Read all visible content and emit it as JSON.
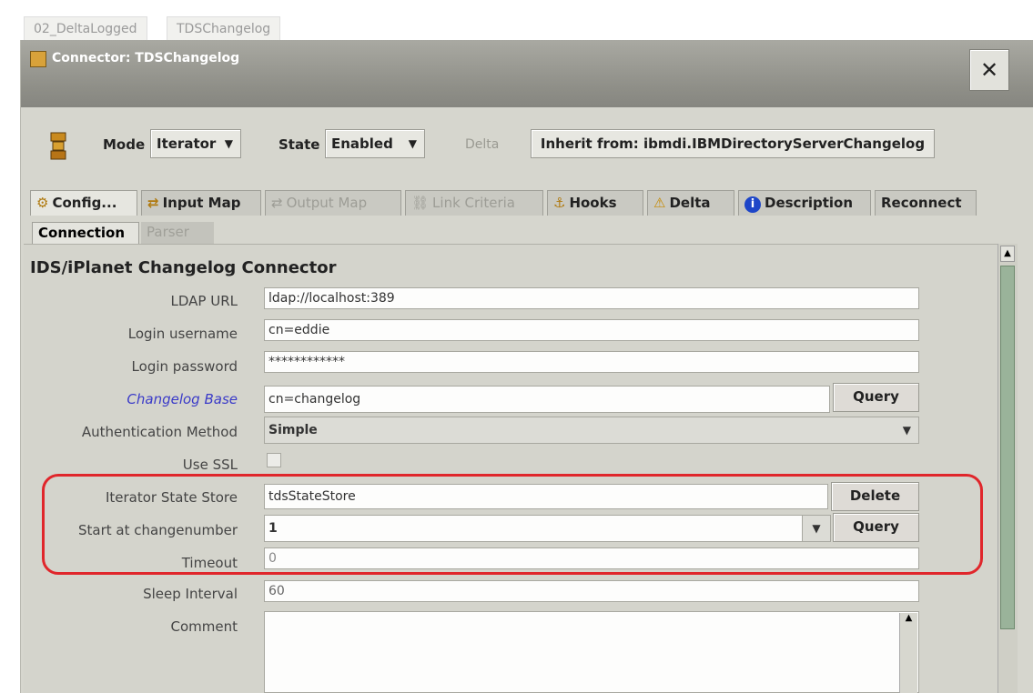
{
  "outer_tabs": [
    "02_DeltaLogged",
    "TDSChangelog"
  ],
  "window": {
    "title": "Connector: TDSChangelog"
  },
  "toolbar": {
    "mode_label": "Mode",
    "mode_value": "Iterator",
    "state_label": "State",
    "state_value": "Enabled",
    "delta_label": "Delta",
    "inherit_label": "Inherit from: ibmdi.IBMDirectoryServerChangelog"
  },
  "tabs": [
    "Config...",
    "Input Map",
    "Output Map",
    "Link Criteria",
    "Hooks",
    "Delta",
    "Description",
    "Reconnect"
  ],
  "subtabs": [
    "Connection",
    "Parser"
  ],
  "section_title": "IDS/iPlanet Changelog Connector",
  "fields": {
    "ldap_url": {
      "label": "LDAP URL",
      "value": "ldap://localhost:389"
    },
    "login_username": {
      "label": "Login username",
      "value": "cn=eddie"
    },
    "login_password": {
      "label": "Login password",
      "value": "************"
    },
    "changelog_base": {
      "label": "Changelog Base",
      "value": "cn=changelog",
      "button": "Query"
    },
    "auth_method": {
      "label": "Authentication Method",
      "value": "Simple"
    },
    "use_ssl": {
      "label": "Use SSL"
    },
    "iterator_state_store": {
      "label": "Iterator State Store",
      "value": "tdsStateStore",
      "button": "Delete"
    },
    "start_changenumber": {
      "label": "Start at changenumber",
      "value": "1",
      "button": "Query"
    },
    "timeout": {
      "label": "Timeout",
      "value": "0"
    },
    "sleep_interval": {
      "label": "Sleep Interval",
      "value": "60"
    },
    "comment": {
      "label": "Comment",
      "value": ""
    }
  },
  "colors": {
    "highlight": "#e0262b",
    "link_label": "#3a3ac8",
    "titlebar": "#8f8f88"
  }
}
